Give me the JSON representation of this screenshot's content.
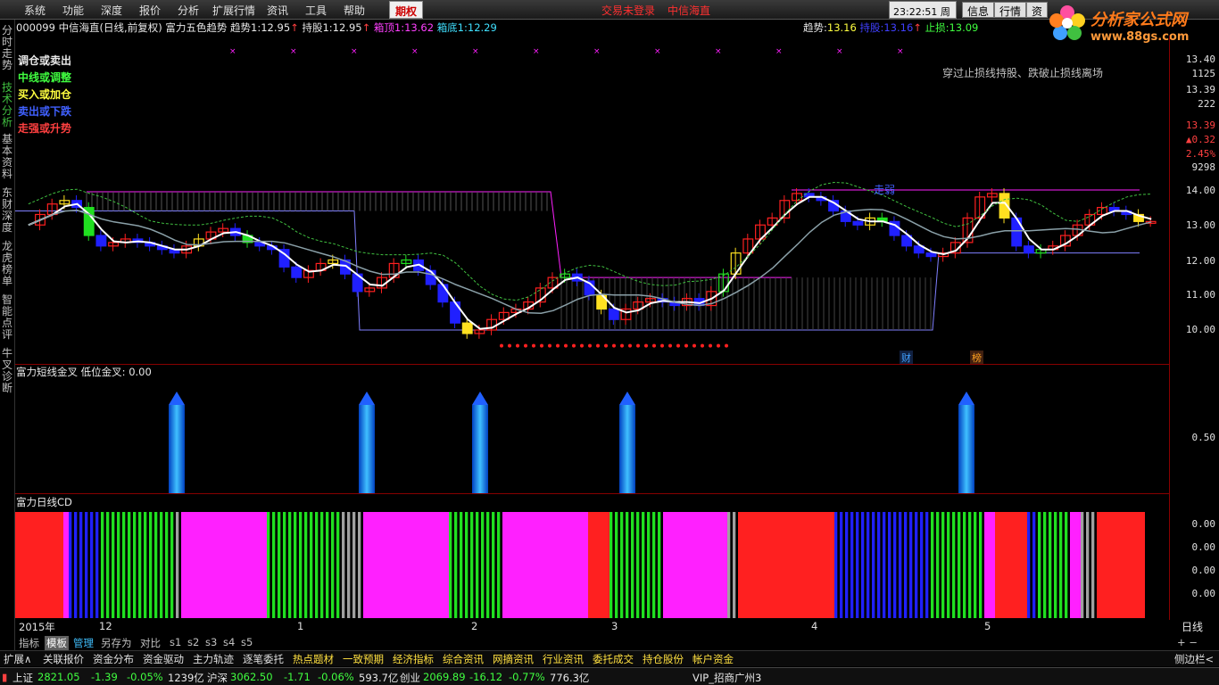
{
  "menubar": {
    "items": [
      "系统",
      "功能",
      "深度",
      "报价",
      "分析",
      "扩展行情",
      "资讯",
      "工具",
      "帮助"
    ],
    "highlight": "期权",
    "trade_status": "交易未登录",
    "broker": "中信海直",
    "time": "23:22:51",
    "weekday": "周日",
    "buttons": [
      "信息",
      "行情",
      "资"
    ]
  },
  "logo": {
    "name": "分析家公式网",
    "url": "www.88gs.com"
  },
  "sidebar_tabs": [
    "分时走势",
    "技术分析",
    "基本资料",
    "东财深度",
    "龙虎榜单",
    "智能点评",
    "牛叉诊断"
  ],
  "info": {
    "code": "000099",
    "name": "中信海直(日线,前复权)",
    "indicator": "富力五色趋势",
    "trend1_label": "趋势1:",
    "trend1_value": "12.95",
    "hold1_label": "持股1:",
    "hold1_value": "12.95",
    "boxtop1_label": "箱顶1:",
    "boxtop1_value": "13.62",
    "boxbot1_label": "箱底1:",
    "boxbot1_value": "12.29",
    "trend_label": "趋势:",
    "trend_value": "13.16",
    "hold_label": "持股:",
    "hold_value": "13.16",
    "stop_label": "止损:",
    "stop_value": "13.09"
  },
  "legend": {
    "l1": "调仓或卖出",
    "l2": "中线或调整",
    "l3": "买入或加仓",
    "l4": "卖出或下跌",
    "l5": "走强或升势"
  },
  "annotations": {
    "note": "穿过止损线持股、跌破止损线离场",
    "zhuqiang": "走弱",
    "cai": "财",
    "bang": "榜"
  },
  "axis_main": [
    "13.40",
    "1125",
    "13.39",
    "222",
    "13.39",
    "▲0.32",
    "2.45%",
    "9298",
    "14.00",
    "13.00",
    "12.00",
    "11.00",
    "10.00"
  ],
  "ind1": {
    "title": "富力短线金叉",
    "label": "低位金叉:",
    "value": "0.00",
    "axis": "0.50"
  },
  "ind2": {
    "title": "富力日线CD",
    "axis": [
      "0.00",
      "0.00",
      "0.00",
      "0.00"
    ]
  },
  "dates": [
    "2015年",
    "12",
    "1",
    "2",
    "3",
    "4",
    "5"
  ],
  "tabs1": [
    "指标",
    "模板",
    "管理",
    "另存为",
    "对比",
    "s1",
    "s2",
    "s3",
    "s4",
    "s5"
  ],
  "tabs2": [
    "扩展∧",
    "关联报价",
    "资金分布",
    "资金驱动",
    "主力轨迹",
    "逐笔委托",
    "热点题材",
    "一致预期",
    "经济指标",
    "综合资讯",
    "网摘资讯",
    "行业资讯",
    "委托成交",
    "持仓股份",
    "帐户资金"
  ],
  "tabs2_right": "侧边栏<",
  "tabs1_right": "+ −",
  "status": {
    "sh_label": "上证",
    "sh_value": "2821.05",
    "sh_chg": "-1.39",
    "sh_pct": "-0.05%",
    "sh_amt": "1239亿",
    "hs_label": "沪深",
    "hs_value": "3062.50",
    "hs_chg": "-1.71",
    "hs_pct": "-0.06%",
    "hs_amt": "593.7亿",
    "cy_label": "创业",
    "cy_value": "2069.89",
    "cy_chg": "-16.12",
    "cy_pct": "-0.77%",
    "cy_amt": "776.3亿",
    "server": "VIP_招商广州3"
  },
  "colors": {
    "up": "#ff2020",
    "down": "#2020ff",
    "green": "#20e020",
    "yellow": "#ffe020",
    "magenta": "#ff20ff",
    "gray": "#a0a0a0",
    "white": "#ffffff"
  }
}
